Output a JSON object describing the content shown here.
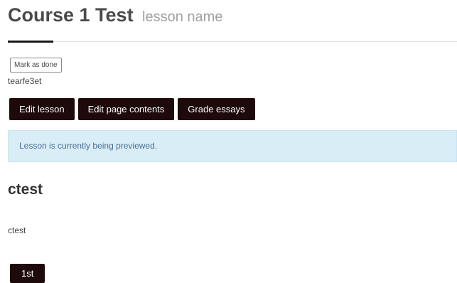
{
  "header": {
    "course_title": "Course 1 Test",
    "lesson_name": "lesson name"
  },
  "completion": {
    "mark_done_label": "Mark as done",
    "note": "tearfe3et"
  },
  "actions": {
    "edit_lesson": "Edit lesson",
    "edit_page_contents": "Edit page contents",
    "grade_essays": "Grade essays"
  },
  "alert": {
    "message": "Lesson is currently being previewed."
  },
  "page": {
    "title": "ctest",
    "body": "ctest"
  },
  "navigation": {
    "button_label": "1st"
  },
  "colors": {
    "button_bg": "#1e0a0a",
    "alert_bg": "#d9edf7",
    "alert_text": "#4a7090"
  }
}
